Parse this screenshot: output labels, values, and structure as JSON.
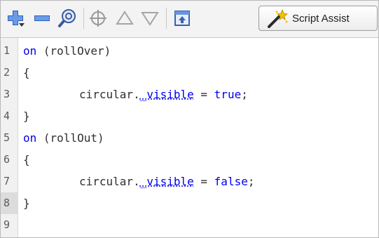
{
  "toolbar": {
    "buttons": [
      {
        "name": "add-statement-button",
        "icon": "plus-icon"
      },
      {
        "name": "delete-statement-button",
        "icon": "minus-icon"
      },
      {
        "name": "find-button",
        "icon": "find-icon"
      },
      {
        "name": "insert-target-path-button",
        "icon": "target-icon"
      },
      {
        "name": "move-up-button",
        "icon": "up-triangle-icon"
      },
      {
        "name": "move-down-button",
        "icon": "down-triangle-icon"
      },
      {
        "name": "collapse-button",
        "icon": "collapse-icon"
      }
    ],
    "script_assist_label": "Script Assist"
  },
  "editor": {
    "current_line": 8,
    "lines": [
      {
        "n": "1",
        "indent": false,
        "tokens": [
          {
            "t": "on",
            "c": "kw"
          },
          {
            "t": " (rollOver)",
            "c": "plain"
          }
        ]
      },
      {
        "n": "2",
        "indent": false,
        "tokens": [
          {
            "t": "{",
            "c": "plain"
          }
        ]
      },
      {
        "n": "3",
        "indent": true,
        "tokens": [
          {
            "t": "circular.",
            "c": "plain"
          },
          {
            "t": "_visible",
            "c": "prop"
          },
          {
            "t": " = ",
            "c": "plain"
          },
          {
            "t": "true",
            "c": "kw"
          },
          {
            "t": ";",
            "c": "plain"
          }
        ]
      },
      {
        "n": "4",
        "indent": false,
        "tokens": [
          {
            "t": "}",
            "c": "plain"
          }
        ]
      },
      {
        "n": "5",
        "indent": false,
        "tokens": [
          {
            "t": "on",
            "c": "kw"
          },
          {
            "t": " (rollOut)",
            "c": "plain"
          }
        ]
      },
      {
        "n": "6",
        "indent": false,
        "tokens": [
          {
            "t": "{",
            "c": "plain"
          }
        ]
      },
      {
        "n": "7",
        "indent": true,
        "tokens": [
          {
            "t": "circular.",
            "c": "plain"
          },
          {
            "t": "_visible",
            "c": "prop"
          },
          {
            "t": " = ",
            "c": "plain"
          },
          {
            "t": "false",
            "c": "kw"
          },
          {
            "t": ";",
            "c": "plain"
          }
        ]
      },
      {
        "n": "8",
        "indent": false,
        "tokens": [
          {
            "t": "}",
            "c": "plain"
          }
        ]
      },
      {
        "n": "9",
        "indent": false,
        "tokens": []
      }
    ]
  }
}
